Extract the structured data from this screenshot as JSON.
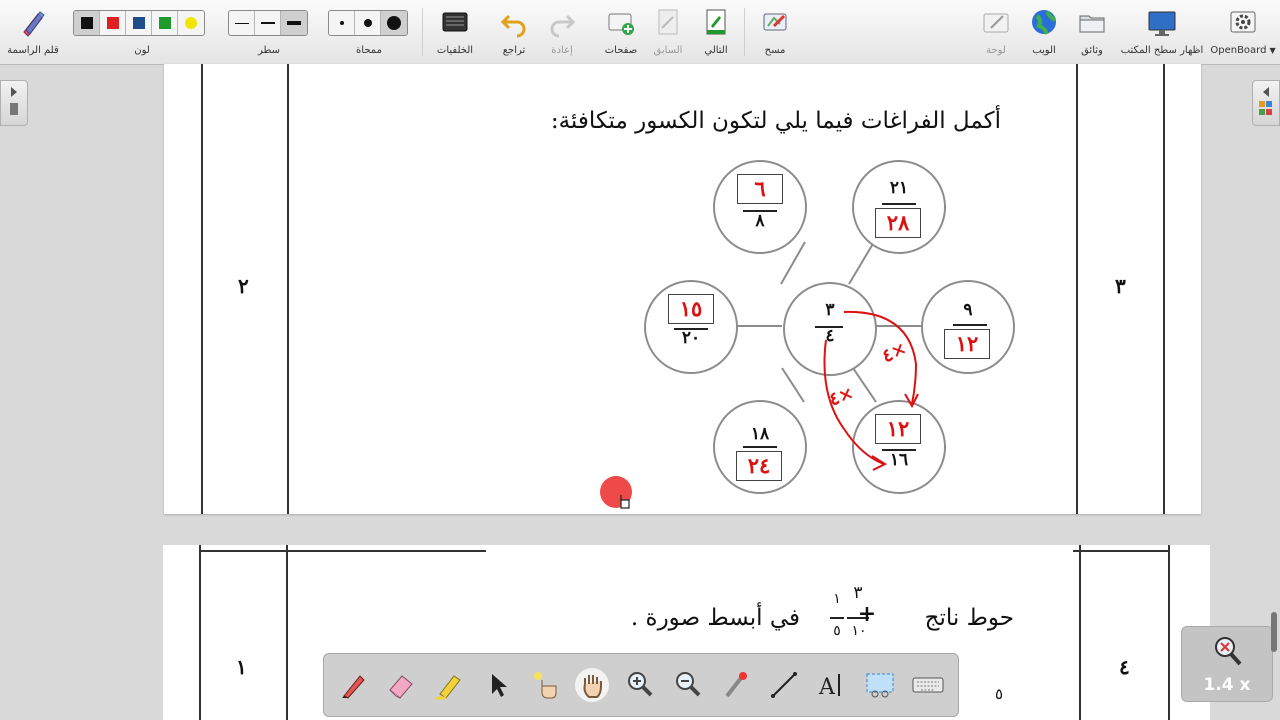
{
  "toolbar": {
    "pen_label": "قلم الراسمة",
    "color_label": "لون",
    "line_label": "سطر",
    "eraser_label": "ممحاة",
    "backgrounds_label": "الخلفيات",
    "undo_label": "تراجع",
    "redo_label": "إعادة",
    "pages_label": "صفحات",
    "previous_label": "السابق",
    "next_label": "التالي",
    "erase_label": "مسح",
    "board_label": "لوحة",
    "web_label": "الويب",
    "documents_label": "وثائق",
    "desktop_label": "اظهار سطح المكتب",
    "app_label": "OpenBoard",
    "colors": [
      "#111111",
      "#e02020",
      "#1d4e8a",
      "#1f9a2a",
      "#f2e600"
    ]
  },
  "page1": {
    "row_left_number": "٢",
    "row_right_number": "٣",
    "question": "أكمل الفراغات فيما يلي لتكون الكسور متكافئة:",
    "center": {
      "numerator": "٣",
      "denominator": "٤"
    },
    "fractions": [
      {
        "top": "٦",
        "bottom": "٨"
      },
      {
        "top": "٢١",
        "bottom": "٢٨"
      },
      {
        "top": "١٥",
        "bottom": "٢٠"
      },
      {
        "top": "٩",
        "bottom": "١٢"
      },
      {
        "top": "١٨",
        "bottom": "٢٤"
      },
      {
        "top": "١٢",
        "bottom": "١٦"
      }
    ],
    "annotations": [
      "٤×",
      "٤×"
    ]
  },
  "page2": {
    "row_left_number": "١",
    "row_right_number": "٤",
    "question": "حوط ناتج ٣/١٠ + ١/٥ في أبسط صورة .",
    "frac_a_num": "٣",
    "frac_a_den": "١٠",
    "frac_b_num": "١",
    "frac_b_den": "٥",
    "plus": "+",
    "partial": "٥"
  },
  "zoom": {
    "level": "1.4 x"
  }
}
